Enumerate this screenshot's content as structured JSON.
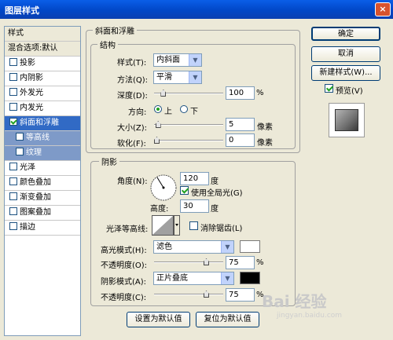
{
  "window": {
    "title": "图层样式",
    "close_glyph": "×"
  },
  "left_panel": {
    "header": "样式",
    "blend_options": "混合选项:默认",
    "items": [
      {
        "label": "投影",
        "checked": false
      },
      {
        "label": "内阴影",
        "checked": false
      },
      {
        "label": "外发光",
        "checked": false
      },
      {
        "label": "内发光",
        "checked": false
      },
      {
        "label": "斜面和浮雕",
        "checked": true
      },
      {
        "label": "等高线",
        "checked": false
      },
      {
        "label": "纹理",
        "checked": false
      },
      {
        "label": "光泽",
        "checked": false
      },
      {
        "label": "颜色叠加",
        "checked": false
      },
      {
        "label": "渐变叠加",
        "checked": false
      },
      {
        "label": "图案叠加",
        "checked": false
      },
      {
        "label": "描边",
        "checked": false
      }
    ]
  },
  "bevel": {
    "group_title": "斜面和浮雕",
    "structure_title": "结构",
    "style_label": "样式(T):",
    "style_value": "内斜面",
    "technique_label": "方法(Q):",
    "technique_value": "平滑",
    "depth_label": "深度(D):",
    "depth_value": "100",
    "depth_unit": "%",
    "depth_level": 0.1,
    "direction_label": "方向:",
    "direction_up": "上",
    "direction_down": "下",
    "direction_selected": "up",
    "size_label": "大小(Z):",
    "size_value": "5",
    "size_unit": "像素",
    "size_level": 0.02,
    "soften_label": "软化(F):",
    "soften_value": "0",
    "soften_unit": "像素",
    "soften_level": 0.0
  },
  "shading": {
    "group_title": "阴影",
    "angle_label": "角度(N):",
    "angle_value": "120",
    "angle_unit": "度",
    "global_light_label": "使用全局光(G)",
    "global_light_checked": true,
    "altitude_label": "高度:",
    "altitude_value": "30",
    "altitude_unit": "度",
    "gloss_contour_label": "光泽等高线:",
    "anti_alias_label": "消除锯齿(L)",
    "anti_alias_checked": false,
    "highlight_mode_label": "高光模式(H):",
    "highlight_mode_value": "滤色",
    "highlight_color": "#ffffff",
    "highlight_opacity_label": "不透明度(O):",
    "highlight_opacity_value": "75",
    "highlight_opacity_unit": "%",
    "highlight_opacity_level": 0.75,
    "shadow_mode_label": "阴影模式(A):",
    "shadow_mode_value": "正片叠底",
    "shadow_color": "#000000",
    "shadow_opacity_label": "不透明度(C):",
    "shadow_opacity_value": "75",
    "shadow_opacity_unit": "%",
    "shadow_opacity_level": 0.75
  },
  "bottom_buttons": {
    "make_default": "设置为默认值",
    "reset_default": "复位为默认值"
  },
  "right_panel": {
    "ok": "确定",
    "cancel": "取消",
    "new_style": "新建样式(W)...",
    "preview_label": "预览(V)",
    "preview_checked": true
  },
  "watermark": {
    "brand": "Bai 经验",
    "url": "jingyan.baidu.com"
  },
  "colors": {
    "selection": "#316ac5",
    "sub_item": "#7e9ac8",
    "dialog_bg": "#ece9d8",
    "titlebar": "#0147c7"
  }
}
